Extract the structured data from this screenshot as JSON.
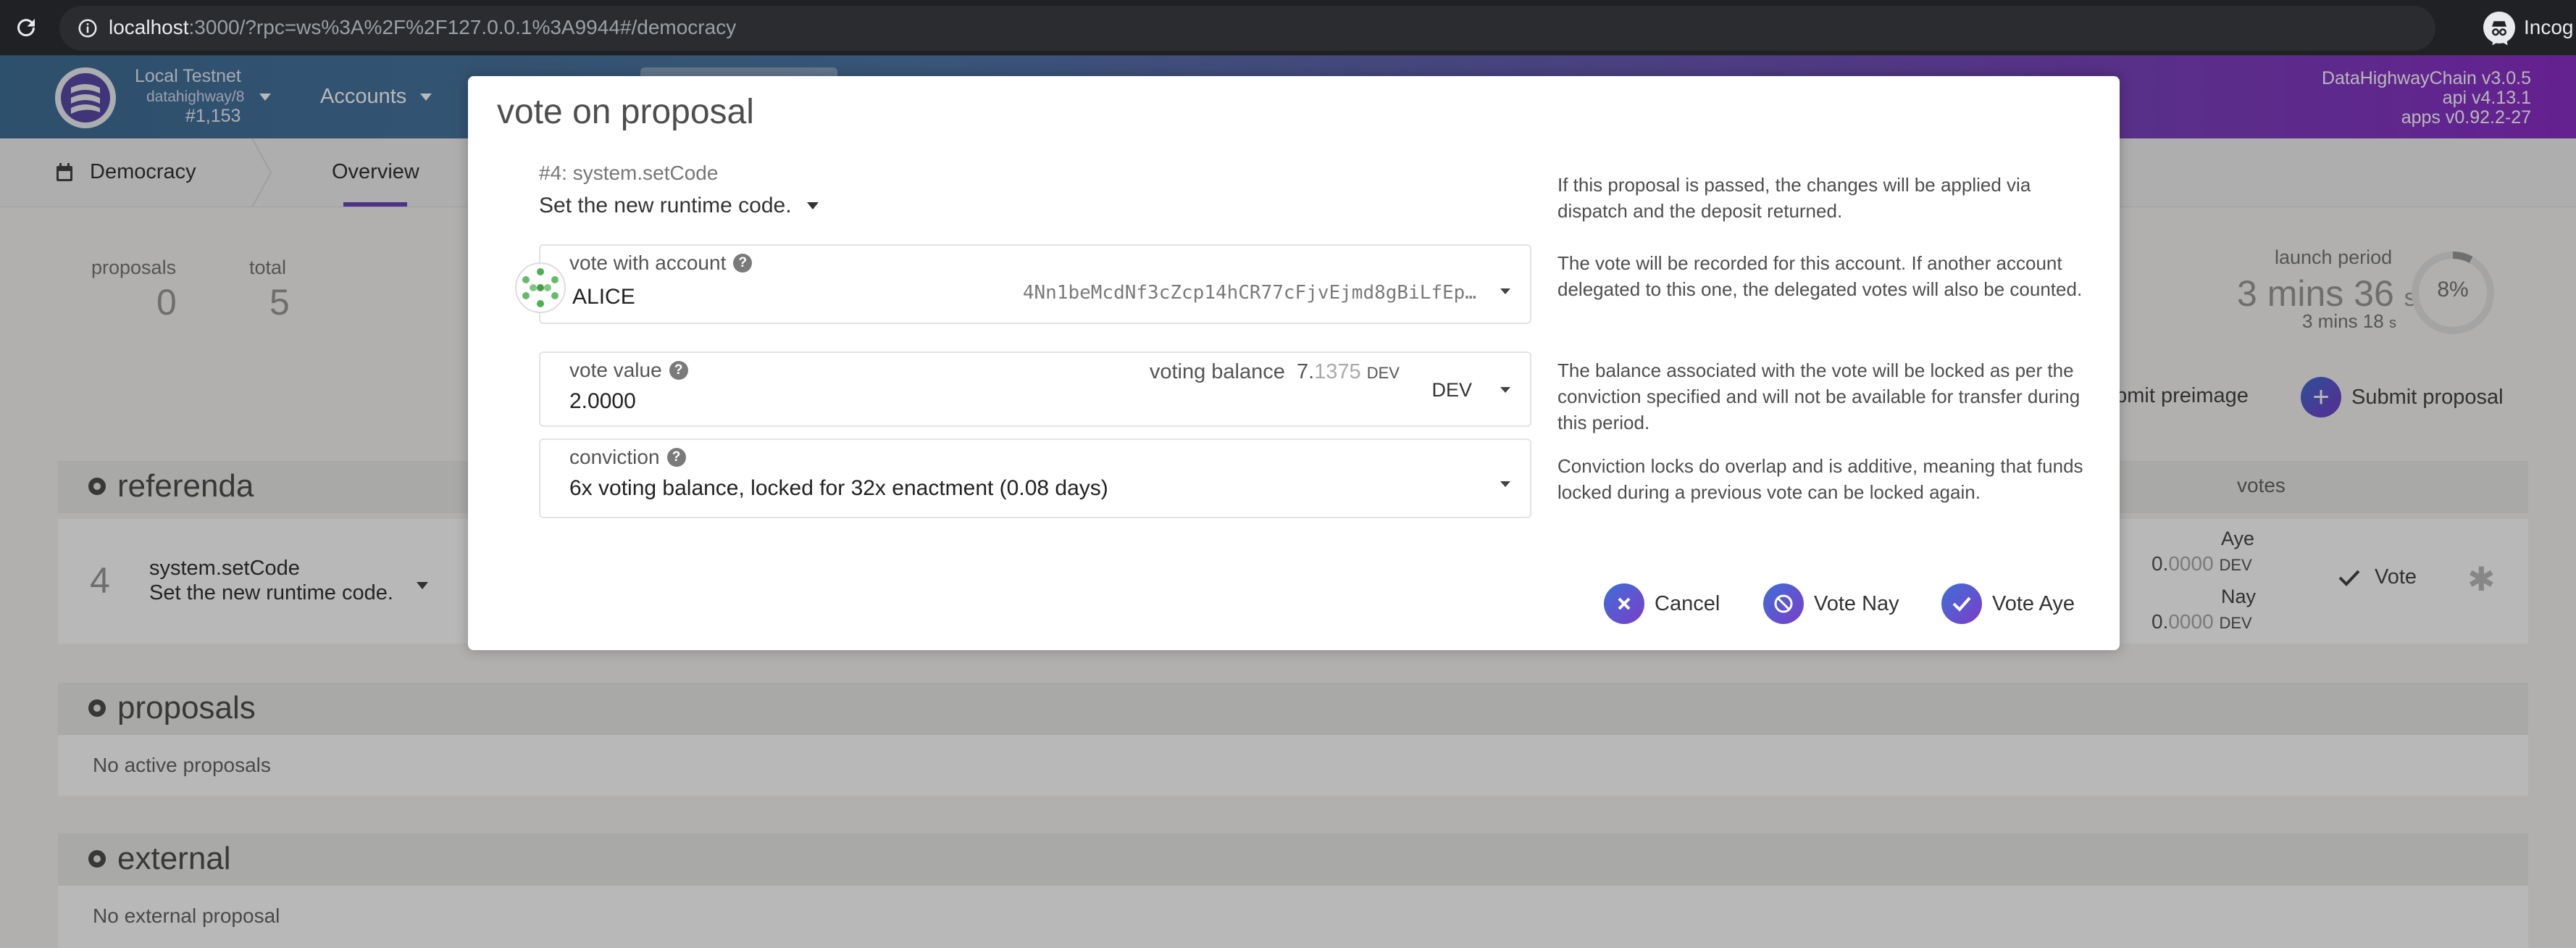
{
  "browser": {
    "url_host": "localhost",
    "url_rest": ":3000/?rpc=ws%3A%2F%2F127.0.0.1%3A9944#/democracy",
    "incognito_label": "Incog"
  },
  "header": {
    "chain_name": "Local Testnet",
    "node": "datahighway/8",
    "block": "#1,153",
    "accounts_menu": "Accounts",
    "versions": [
      "DataHighwayChain v3.0.5",
      "api v4.13.1",
      "apps v0.92.2-27"
    ]
  },
  "subnav": {
    "section": "Democracy",
    "tab_overview": "Overview"
  },
  "summary": {
    "proposals_label": "proposals",
    "proposals_value": "0",
    "total_label": "total",
    "total_value": "5",
    "launch_label": "launch period",
    "launch_time_main": "3 mins 36",
    "launch_time_unit": "s",
    "launch_sub_main": "3 mins 18",
    "launch_sub_unit": "s",
    "progress_percent": 8,
    "progress_label": "8%"
  },
  "actions": {
    "submit_preimage": "ubmit preimage",
    "submit_proposal": "Submit proposal"
  },
  "referenda": {
    "title": "referenda",
    "votes_header": "votes",
    "item": {
      "index": "4",
      "call": "system.setCode",
      "desc": "Set the new runtime code.",
      "aye_label": "Aye",
      "aye_int": "0.",
      "aye_dec": "0000",
      "aye_unit": "DEV",
      "nay_label": "Nay",
      "nay_int": "0.",
      "nay_dec": "0000",
      "nay_unit": "DEV",
      "vote_label": "Vote"
    }
  },
  "proposals": {
    "title": "proposals",
    "empty": "No active proposals"
  },
  "external": {
    "title": "external",
    "empty": "No external proposal"
  },
  "modal": {
    "title": "vote on proposal",
    "proposal_id": "#4: system.setCode",
    "proposal_desc": "Set the new runtime code.",
    "account_label": "vote with account",
    "account_name": "ALICE",
    "account_address": "4Nn1beMcdNf3cZcp14hCR77cFjvEjmd8gBiLfEp…",
    "vote_value_label": "vote value",
    "voting_balance_label": "voting balance",
    "voting_balance_int": "7.",
    "voting_balance_dec": "1375",
    "voting_balance_unit": "DEV",
    "vote_value": "2.0000",
    "unit": "DEV",
    "conviction_label": "conviction",
    "conviction_value": "6x voting balance, locked for 32x enactment (0.08 days)",
    "help_proposal": "If this proposal is passed, the changes will be applied via dispatch and the deposit returned.",
    "help_account": "The vote will be recorded for this account. If another account delegated to this one, the delegated votes will also be counted.",
    "help_value": "The balance associated with the vote will be locked as per the conviction specified and will not be available for transfer during this period.",
    "help_conviction": "Conviction locks do overlap and is additive, meaning that funds locked during a previous vote can be locked again.",
    "cancel": "Cancel",
    "vote_nay": "Vote Nay",
    "vote_aye": "Vote Aye"
  }
}
